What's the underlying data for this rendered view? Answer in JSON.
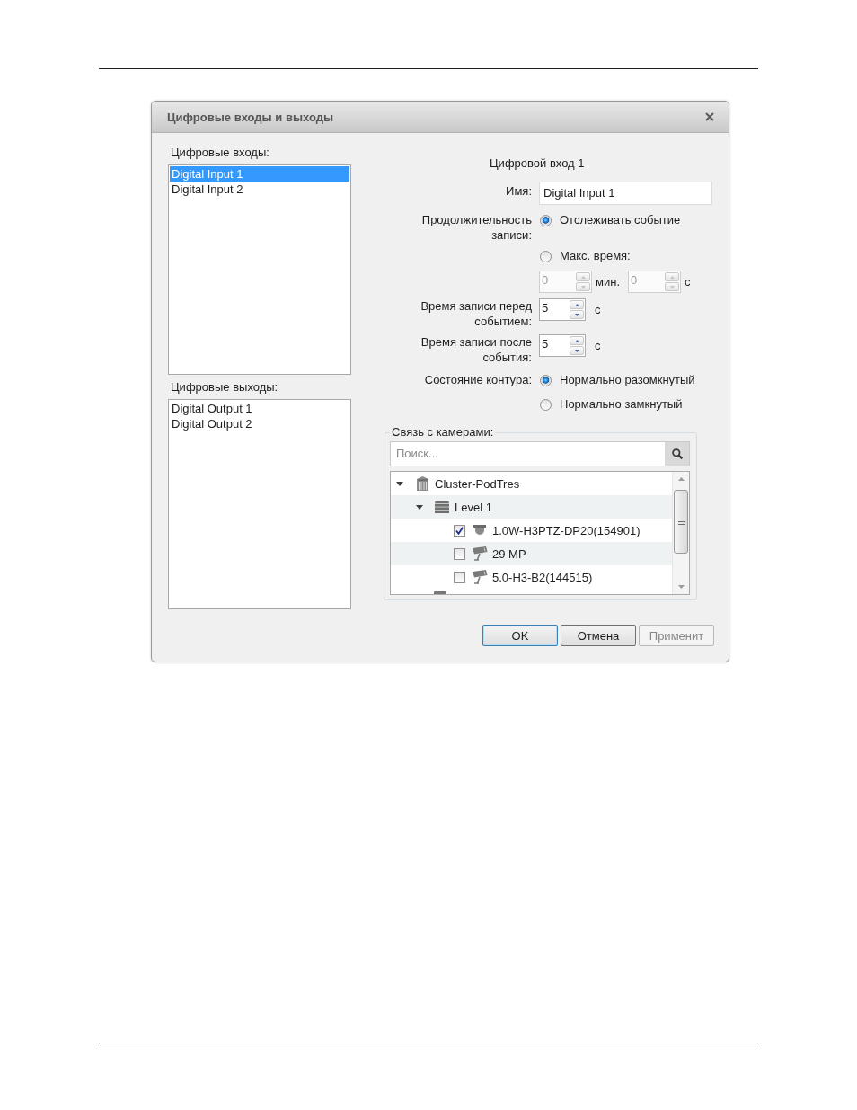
{
  "window": {
    "title": "Цифровые входы и выходы"
  },
  "inputs": {
    "label": "Цифровые входы:",
    "items": [
      {
        "label": "Digital Input 1",
        "selected": true
      },
      {
        "label": "Digital Input 2",
        "selected": false
      }
    ]
  },
  "outputs": {
    "label": "Цифровые выходы:",
    "items": [
      {
        "label": "Digital Output 1",
        "selected": false
      },
      {
        "label": "Digital Output 2",
        "selected": false
      }
    ]
  },
  "details": {
    "heading": "Цифровой вход 1",
    "name": {
      "label": "Имя:",
      "value": "Digital Input 1"
    },
    "duration": {
      "label": "Продолжительность записи:",
      "options": [
        {
          "label": "Отслеживать событие",
          "selected": true
        },
        {
          "label": "Макс. время:",
          "selected": false
        }
      ],
      "max_time": {
        "disabled": true,
        "fields": [
          {
            "value": "0",
            "unit": "мин."
          },
          {
            "value": "0",
            "unit": "с"
          }
        ]
      }
    },
    "pre_event": {
      "label": "Время записи перед событием:",
      "value": "5",
      "unit": "с"
    },
    "post_event": {
      "label": "Время записи после события:",
      "value": "5",
      "unit": "с"
    },
    "contact_state": {
      "label": "Состояние контура:",
      "options": [
        {
          "label": "Нормально разомкнутый",
          "selected": true
        },
        {
          "label": "Нормально замкнутый",
          "selected": false
        }
      ]
    },
    "cameras": {
      "label": "Связь с камерами:",
      "search": {
        "placeholder": "Поиск..."
      },
      "tree": [
        {
          "label": "Cluster-PodTres",
          "kind": "cluster",
          "expanded": true,
          "children": [
            {
              "label": "Level 1",
              "kind": "server",
              "expanded": true,
              "children": [
                {
                  "label": "1.0W-H3PTZ-DP20(154901)",
                  "kind": "dome-camera",
                  "checked": true
                },
                {
                  "label": "29 MP",
                  "kind": "box-camera",
                  "checked": false
                },
                {
                  "label": "5.0-H3-B2(144515)",
                  "kind": "box-camera",
                  "checked": false
                }
              ]
            }
          ]
        }
      ]
    }
  },
  "buttons": [
    {
      "label": "OK",
      "default": true,
      "disabled": false
    },
    {
      "label": "Отмена",
      "default": false,
      "disabled": false
    },
    {
      "label": "Применит",
      "default": false,
      "disabled": true
    }
  ]
}
